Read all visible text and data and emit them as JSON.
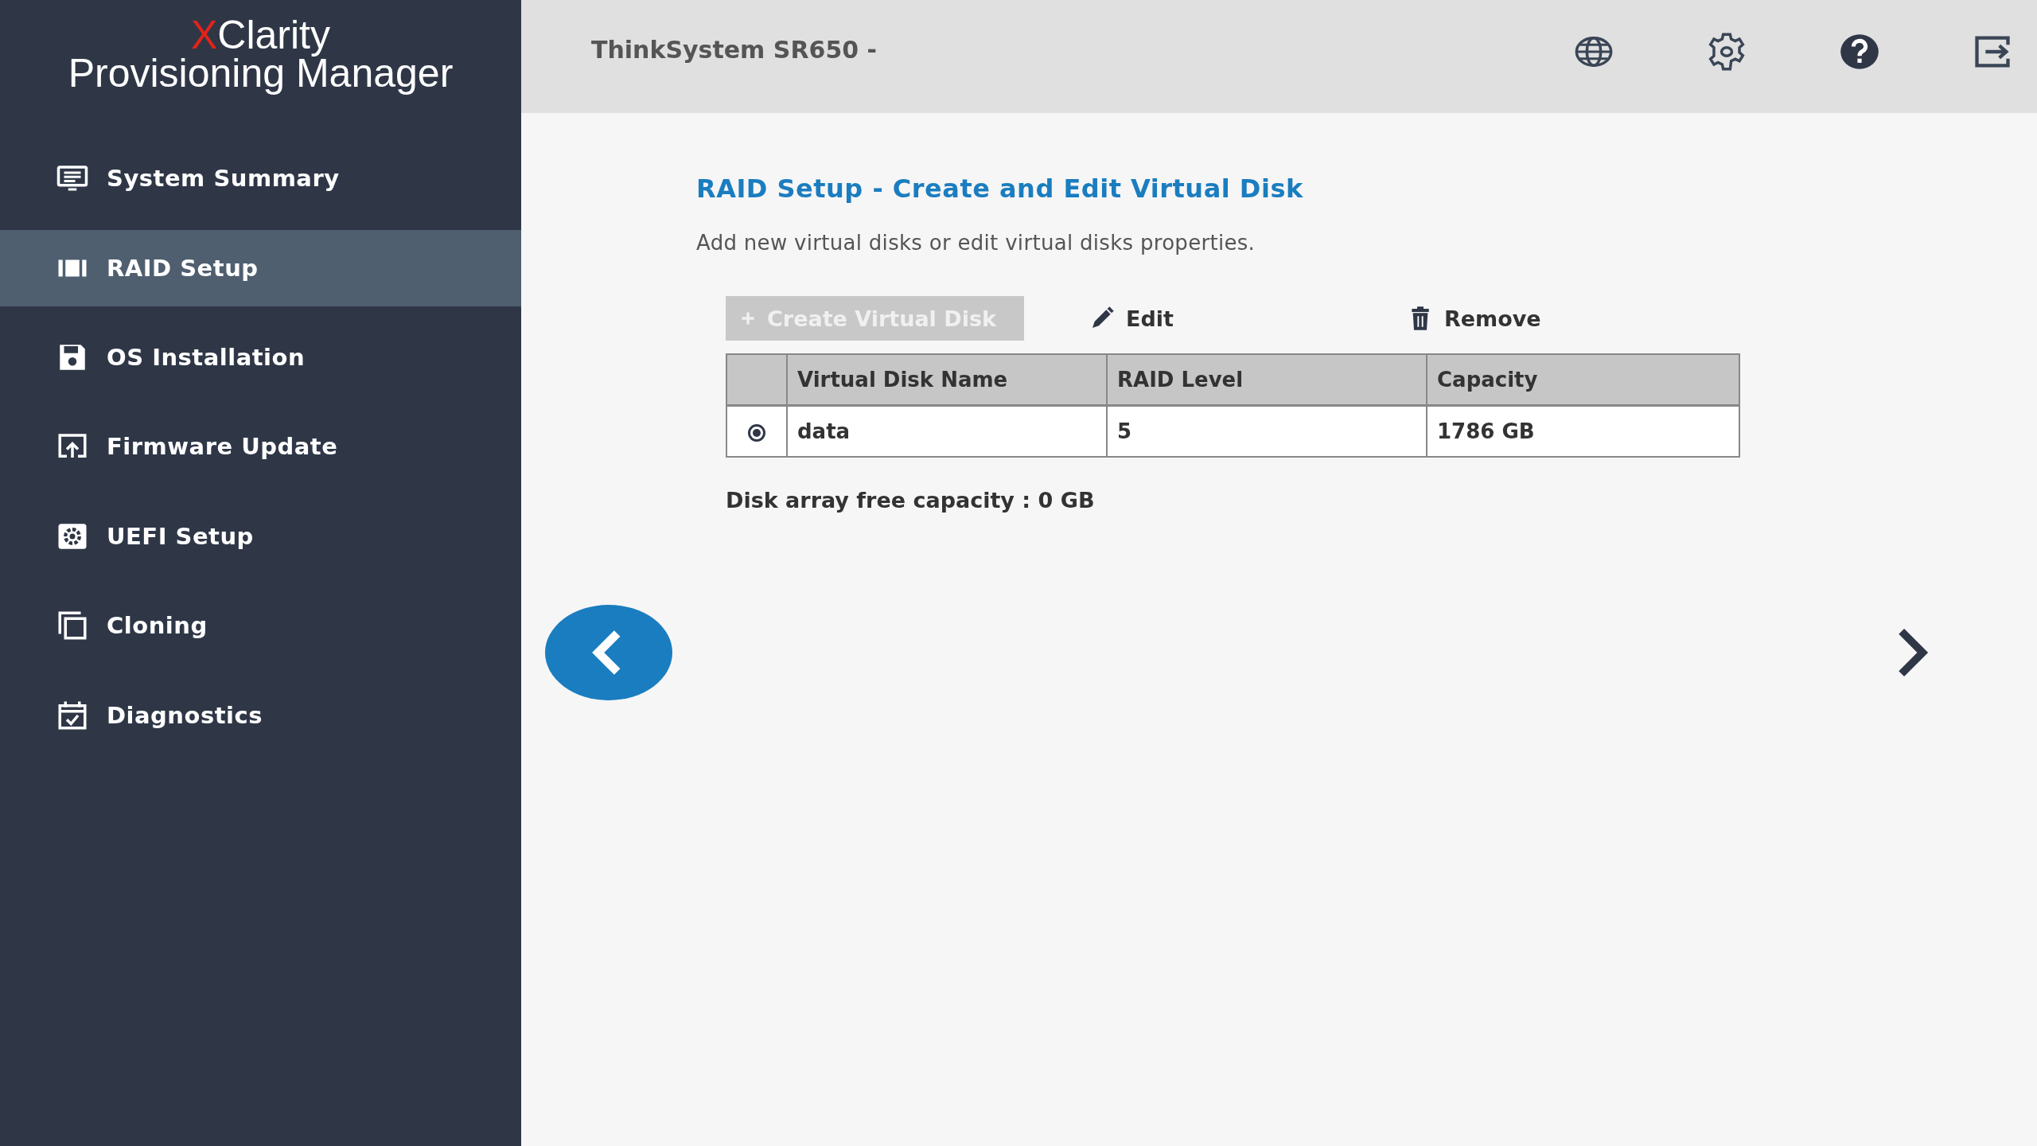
{
  "logo": {
    "mark": "X",
    "name": "Clarity",
    "product": "Provisioning Manager"
  },
  "sidebar": {
    "items": [
      {
        "label": "System Summary",
        "kind": "summary",
        "selected": false
      },
      {
        "label": "RAID Setup",
        "kind": "raid",
        "selected": true
      },
      {
        "label": "OS Installation",
        "kind": "disk",
        "selected": false
      },
      {
        "label": "Firmware Update",
        "kind": "update",
        "selected": false
      },
      {
        "label": "UEFI Setup",
        "kind": "uefi",
        "selected": false
      },
      {
        "label": "Cloning",
        "kind": "clone",
        "selected": false
      },
      {
        "label": "Diagnostics",
        "kind": "diag",
        "selected": false
      }
    ]
  },
  "header": {
    "title": "ThinkSystem SR650 -"
  },
  "page": {
    "title": "RAID Setup - Create and Edit Virtual Disk",
    "description": "Add new virtual disks or edit virtual disks properties."
  },
  "toolbar": [
    {
      "label": "Create Virtual Disk",
      "kind": "create",
      "disabled": true
    },
    {
      "label": "Edit",
      "kind": "edit",
      "disabled": false
    },
    {
      "label": "Remove",
      "kind": "remove",
      "disabled": false
    }
  ],
  "table": {
    "columns": [
      "Virtual Disk Name",
      "RAID Level",
      "Capacity"
    ],
    "rows": [
      {
        "selected": true,
        "cells": [
          "data",
          "5",
          "1786 GB"
        ]
      }
    ]
  },
  "free_capacity": "Disk array free capacity : 0 GB"
}
